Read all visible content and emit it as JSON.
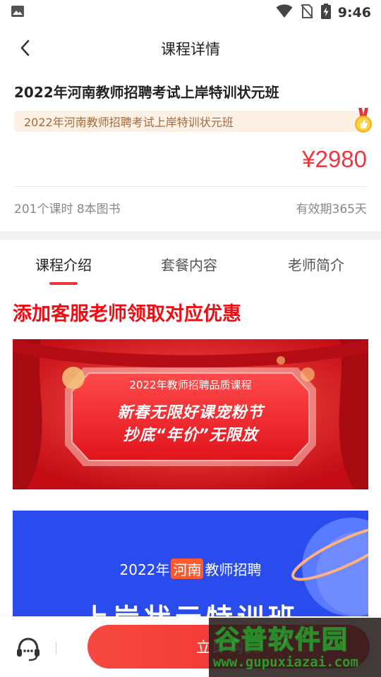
{
  "status_bar": {
    "time": "9:46",
    "icons": [
      "image-icon",
      "wifi-icon",
      "no-sim-icon",
      "battery-charging-icon"
    ]
  },
  "header": {
    "title": "课程详情",
    "back_icon": "chevron-left-icon"
  },
  "course": {
    "title": "2022年河南教师招聘考试上岸特训状元班",
    "banner_text": "2022年河南教师招聘考试上岸特训状元班",
    "banner_icon": "medal-thumb-icon",
    "price": "¥2980",
    "lessons_info": "201个课时 8本图书",
    "validity": "有效期365天"
  },
  "tabs": [
    {
      "label": "课程介绍",
      "active": true
    },
    {
      "label": "套餐内容",
      "active": false
    },
    {
      "label": "老师简介",
      "active": false
    }
  ],
  "intro": {
    "heading": "添加客服老师领取对应优惠",
    "banner1": {
      "subtitle": "2022年教师招聘品质课程",
      "line1": "新春无限好课宠粉节",
      "line2": "抄底“年价”无限放"
    },
    "banner2": {
      "prefix": "2022年",
      "highlight": "河南",
      "suffix": "教师招聘",
      "title": "上岸状元特训班"
    }
  },
  "bottom_bar": {
    "service_icon": "customer-service-icon",
    "buy_label": "立即购买"
  },
  "watermark": {
    "logo": "谷普软件园",
    "url": "www.gupuxiazai.com"
  },
  "colors": {
    "accent": "#f0353c",
    "promo_red": "#f00c12",
    "banner_tag_bg": "#fdf0e4",
    "banner_tag_text": "#a46a3c",
    "blue_banner": "#2a4cef"
  }
}
